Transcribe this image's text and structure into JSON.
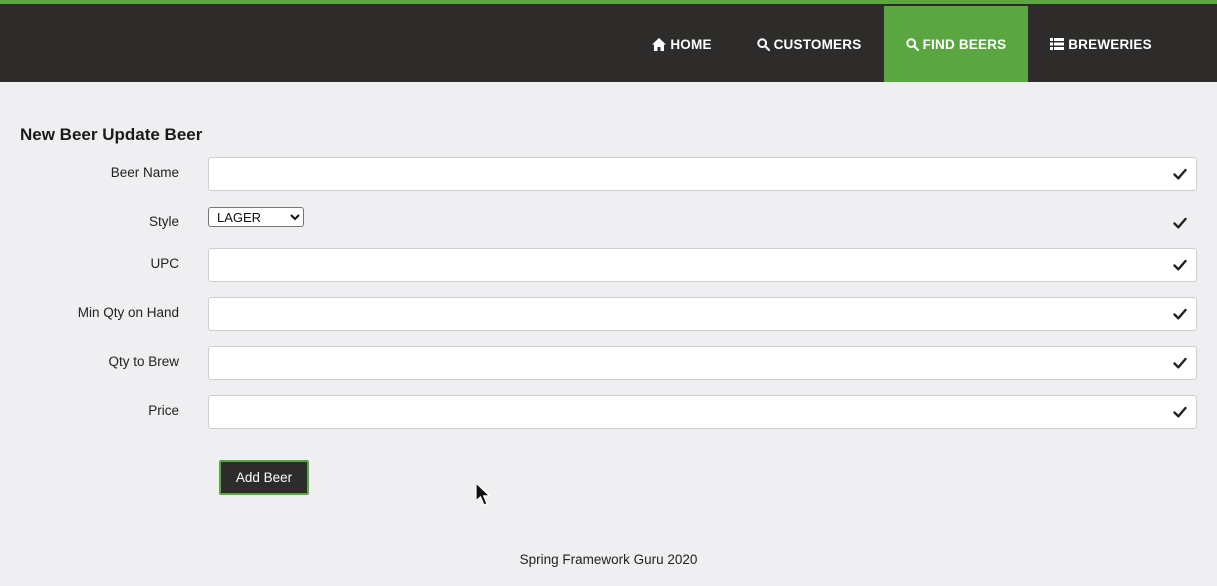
{
  "colors": {
    "navbar_bg": "#2d2c2a",
    "accent_green": "#5aa640",
    "page_bg": "#efeef0",
    "button_bg": "#2d2c2a"
  },
  "nav": {
    "items": [
      {
        "icon": "home-icon",
        "label": "HOME",
        "active": false
      },
      {
        "icon": "search-icon",
        "label": "CUSTOMERS",
        "active": false
      },
      {
        "icon": "search-icon",
        "label": "FIND BEERS",
        "active": true
      },
      {
        "icon": "list-icon",
        "label": "BREWERIES",
        "active": false
      }
    ]
  },
  "form": {
    "title": "New Beer Update Beer",
    "fields": {
      "beer_name": {
        "label": "Beer Name",
        "value": ""
      },
      "style": {
        "label": "Style",
        "selected": "LAGER"
      },
      "upc": {
        "label": "UPC",
        "value": ""
      },
      "min_qty": {
        "label": "Min Qty on Hand",
        "value": ""
      },
      "qty_to_brew": {
        "label": "Qty to Brew",
        "value": ""
      },
      "price": {
        "label": "Price",
        "value": ""
      }
    },
    "submit_label": "Add Beer"
  },
  "footer": {
    "text": "Spring Framework Guru 2020"
  }
}
